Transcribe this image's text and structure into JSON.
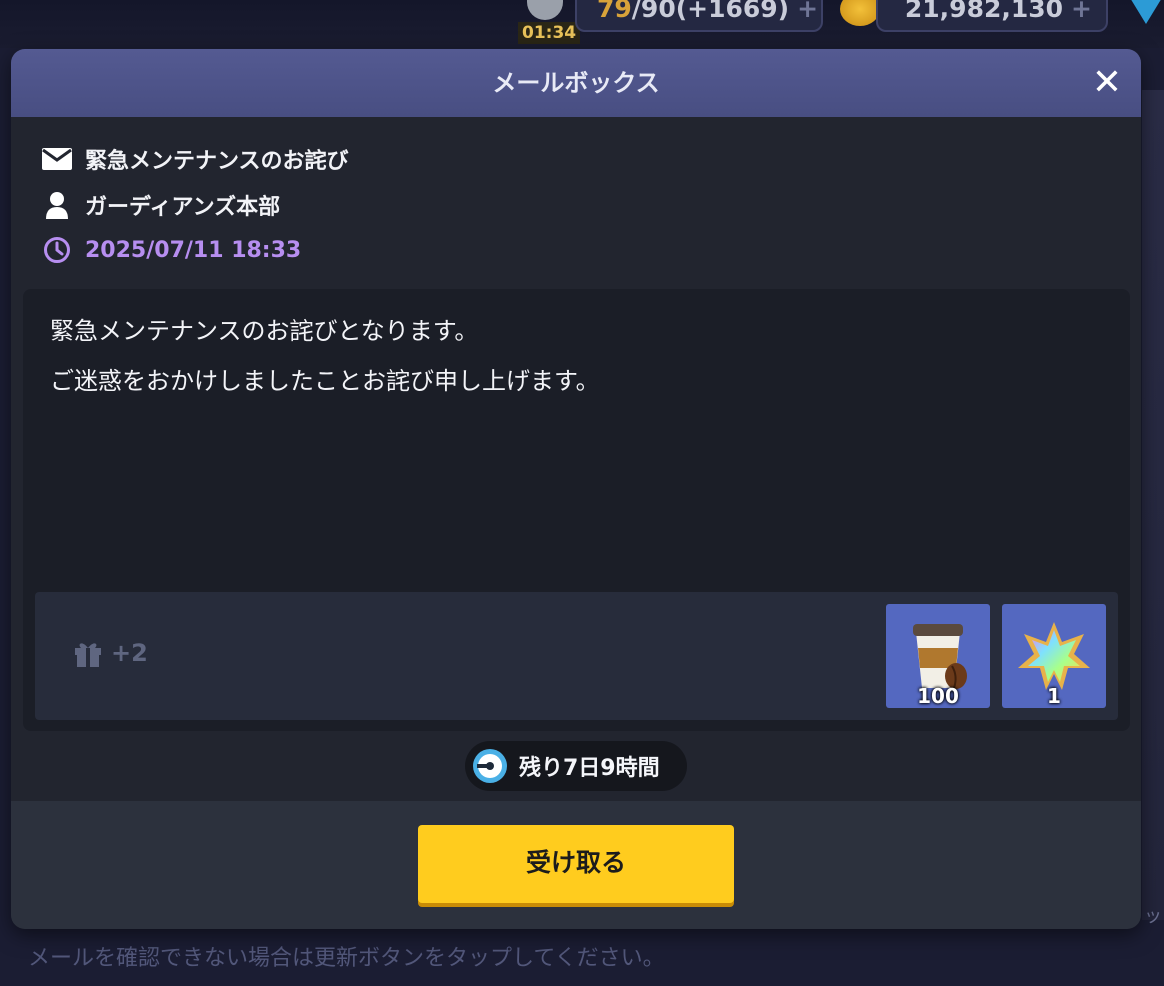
{
  "hud": {
    "timer": "01:34",
    "stamina_current": "79",
    "stamina_rest": "/90(+1669)",
    "stamina_plus": "+",
    "gold": "21,982,130",
    "gold_plus": "+"
  },
  "mail": {
    "window_title": "メールボックス",
    "close_label": "✕",
    "subject": "緊急メンテナンスのお詫び",
    "sender": "ガーディアンズ本部",
    "date": "2025/07/11 18:33",
    "body_lines": [
      "緊急メンテナンスのお詫びとなります。",
      "ご迷惑をおかけしましたことお詫び申し上げます。"
    ],
    "reward_count": "+2",
    "rewards": [
      {
        "icon": "coffee-cup-icon",
        "quantity": "100"
      },
      {
        "icon": "rainbow-crystal-icon",
        "quantity": "1"
      }
    ],
    "remaining_time": "残り7日9時間",
    "claim_label": "受け取る"
  },
  "footer_hint": "メールを確認できない場合は更新ボタンをタップしてください。",
  "colors": {
    "header": "#4e548a",
    "accent_date": "#b78ef0",
    "claim_button": "#ffcc1e",
    "item_tile": "#5468c0"
  }
}
